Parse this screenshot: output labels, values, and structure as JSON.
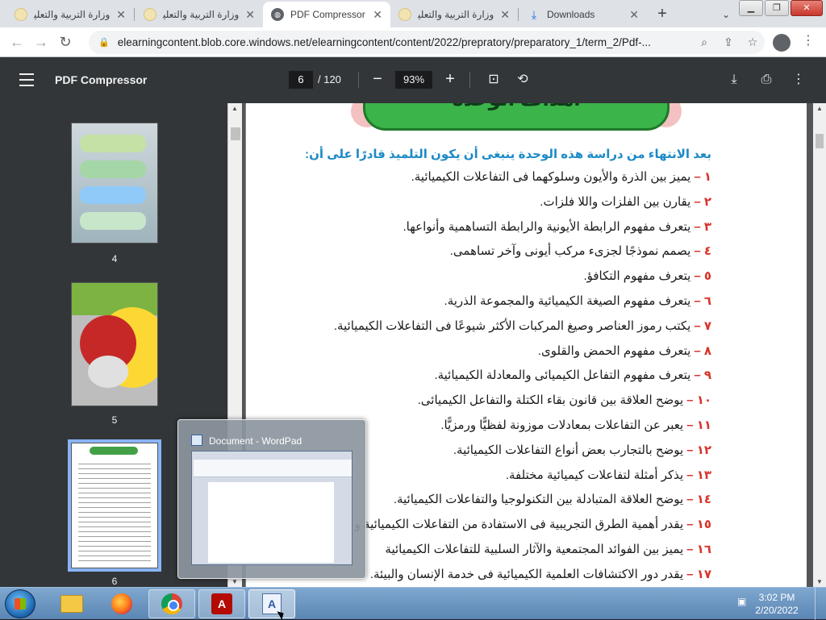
{
  "browser": {
    "tabs": [
      {
        "title": "وزارة التربية والتعليم",
        "icon": "moe-favicon-icon",
        "active": false
      },
      {
        "title": "وزارة التربية والتعليم",
        "icon": "moe-favicon-icon",
        "active": false
      },
      {
        "title": "PDF Compressor",
        "icon": "globe-icon",
        "active": true
      },
      {
        "title": "وزارة التربية والتعليم",
        "icon": "moe-favicon-icon",
        "active": false
      },
      {
        "title": "Downloads",
        "icon": "download-icon",
        "active": false
      }
    ],
    "new_tab_label": "+",
    "url": "elearningcontent.blob.core.windows.net/elearningcontent/content/2022/prepratory/preparatory_1/term_2/Pdf-..."
  },
  "pdf_viewer": {
    "title": "PDF Compressor",
    "current_page": "6",
    "total_pages": "/ 120",
    "zoom": "93%",
    "thumbnails": [
      {
        "label": "4"
      },
      {
        "label": "5"
      },
      {
        "label": "6",
        "selected": true
      }
    ]
  },
  "page_content": {
    "banner": "أهداف الوحدة",
    "intro": "بعد الانتهاء من دراسة هذه الوحدة ينبغى أن يكون التلميذ قادرًا على أن:",
    "objectives": [
      {
        "num": "١ –",
        "text": "يميز بين الذرة والأيون وسلوكهما فى التفاعلات الكيميائية."
      },
      {
        "num": "٢ –",
        "text": "يقارن بين الفلزات واللا فلزات."
      },
      {
        "num": "٣ –",
        "text": "يتعرف مفهوم الرابطة الأيونية والرابطة التساهمية وأنواعها."
      },
      {
        "num": "٤ –",
        "text": "يصمم نموذجًا لجزىء مركب أيونى وآخر تساهمى."
      },
      {
        "num": "٥ –",
        "text": "يتعرف مفهوم التكافؤ."
      },
      {
        "num": "٦ –",
        "text": "يتعرف مفهوم الصيغة الكيميائية والمجموعة الذرية."
      },
      {
        "num": "٧ –",
        "text": "يكتب رموز العناصر وصيغ المركبات الأكثر شيوعًا فى التفاعلات الكيميائية."
      },
      {
        "num": "٨ –",
        "text": "يتعرف مفهوم الحمض والقلوى."
      },
      {
        "num": "٩ –",
        "text": "يتعرف مفهوم التفاعل الكيميائى والمعادلة الكيميائية."
      },
      {
        "num": "١٠ –",
        "text": "يوضح العلاقة بين قانون بقاء الكتلة والتفاعل الكيميائى."
      },
      {
        "num": "١١ –",
        "text": "يعبر عن التفاعلات بمعادلات موزونة لفظيًّا ورمزيًّا."
      },
      {
        "num": "١٢ –",
        "text": "يوضح بالتجارب بعض أنواع التفاعلات الكيميائية."
      },
      {
        "num": "١٣ –",
        "text": "يذكر أمثلة لتفاعلات كيميائية مختلفة."
      },
      {
        "num": "١٤ –",
        "text": "يوضح العلاقة المتبادلة بين التكنولوجيا والتفاعلات الكيميائية."
      },
      {
        "num": "١٥ –",
        "text": "يقدر أهمية الطرق التجريبية فى الاستفادة من التفاعلات الكيميائية و"
      },
      {
        "num": "١٦ –",
        "text": "يميز بين الفوائد المجتمعية والآثار السلبية للتفاعلات الكيميائية"
      },
      {
        "num": "١٧ –",
        "text": "يقدر دور الاكتشافات العلمية الكيميائية فى خدمة الإنسان والبيئة."
      }
    ]
  },
  "taskbar_preview": {
    "title": "Document - WordPad"
  },
  "taskbar": {
    "apps": [
      {
        "name": "file-explorer"
      },
      {
        "name": "firefox"
      },
      {
        "name": "chrome"
      },
      {
        "name": "adobe-reader"
      },
      {
        "name": "wordpad"
      }
    ],
    "time": "3:02 PM",
    "date": "2/20/2022"
  },
  "colors": {
    "pdf_toolbar": "#323639",
    "intro_text": "#1d8ac6",
    "objective_number": "#d9342b",
    "banner_green": "#3bb44a"
  }
}
